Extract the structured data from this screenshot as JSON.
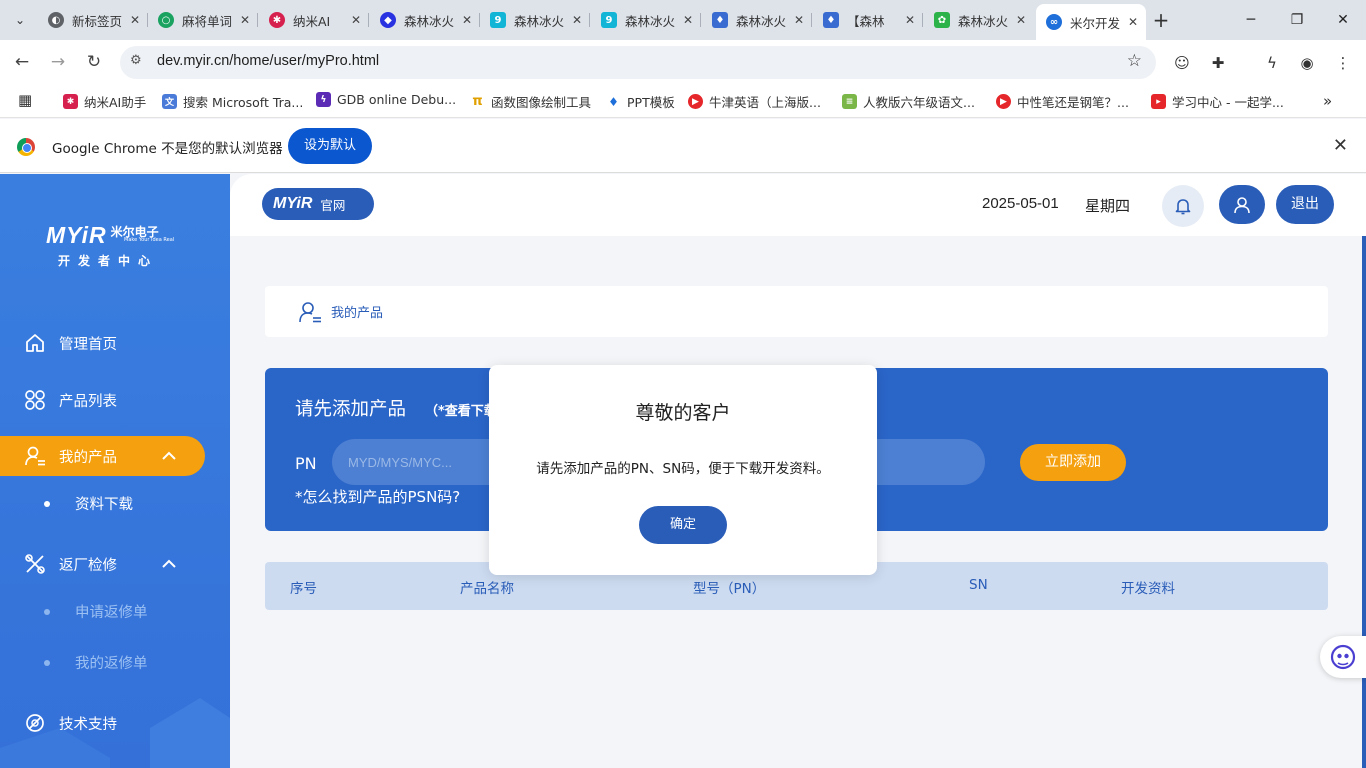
{
  "browser": {
    "tabs": [
      {
        "label": "新标签页",
        "favicon": "chrome-icon",
        "color": "#5f6368"
      },
      {
        "label": "麻将单词",
        "favicon": "loop-icon",
        "color": "#1aa260"
      },
      {
        "label": "纳米AI",
        "favicon": "nami-ai-icon",
        "color": "#d6204e"
      },
      {
        "label": "森林冰火",
        "favicon": "baidu-paw-icon",
        "color": "#2932e1"
      },
      {
        "label": "森林冰火",
        "favicon": "game-9-icon",
        "color": "#13b5d6"
      },
      {
        "label": "森林冰火",
        "favicon": "game-9-icon",
        "color": "#13b5d6"
      },
      {
        "label": "森林冰火",
        "favicon": "fire-water-icon",
        "color": "#3a6bd1"
      },
      {
        "label": "【森林",
        "favicon": "fire-water-icon",
        "color": "#3a6bd1"
      },
      {
        "label": "森林冰火",
        "favicon": "leaf-icon",
        "color": "#2bb34a"
      },
      {
        "label": "米尔开发",
        "favicon": "myir-icon",
        "color": "#1e6fd9"
      }
    ],
    "url": "dev.myir.cn/home/user/myPro.html",
    "bookmarks": [
      {
        "label": "纳米AI助手",
        "icon": "nami-ai-icon",
        "color": "#d6204e"
      },
      {
        "label": "搜索 Microsoft Tra...",
        "icon": "translator-icon",
        "color": "#4b7bd8"
      },
      {
        "label": "GDB online Debu...",
        "icon": "gdb-icon",
        "color": "#5b2bb5"
      },
      {
        "label": "函数图像绘制工具",
        "icon": "pi-icon",
        "color": "#e0a100"
      },
      {
        "label": "PPT模板",
        "icon": "ppt-icon",
        "color": "#1e6fd9"
      },
      {
        "label": "牛津英语（上海版...",
        "icon": "video-icon",
        "color": "#e5262a"
      },
      {
        "label": "人教版六年级语文...",
        "icon": "book-icon",
        "color": "#7ab648"
      },
      {
        "label": "中性笔还是钢笔？...",
        "icon": "video-icon",
        "color": "#e5262a"
      },
      {
        "label": "学习中心 - 一起学...",
        "icon": "study-icon",
        "color": "#e5262a"
      }
    ],
    "infobar": {
      "message": "Google Chrome 不是您的默认浏览器",
      "button": "设为默认"
    }
  },
  "sidebar": {
    "logo": {
      "brand": "MYiR",
      "cn": "米尔电子",
      "slogan": "Make Your Idea Real",
      "sub": "开发者中心"
    },
    "items": [
      {
        "label": "管理首页",
        "icon": "home-icon"
      },
      {
        "label": "产品列表",
        "icon": "grid-icon"
      },
      {
        "label": "我的产品",
        "icon": "user-list-icon",
        "active": true
      },
      {
        "label": "返厂检修",
        "icon": "tools-icon"
      },
      {
        "label": "技术支持",
        "icon": "support-icon"
      }
    ],
    "submenus": {
      "my_products": [
        "资料下载"
      ],
      "repair": [
        "申请返修单",
        "我的返修单"
      ]
    }
  },
  "header": {
    "brand_logo": "MYiR",
    "brand_site": "官网",
    "date": "2025-05-01",
    "weekday": "星期四",
    "logout": "退出"
  },
  "content": {
    "breadcrumb": "我的产品",
    "add_title": "请先添加产品",
    "add_hint": "（*查看下载",
    "pn_label": "PN",
    "pn_placeholder": "MYD/MYS/MYC...",
    "add_button": "立即添加",
    "psn_link": "*怎么找到产品的PSN码?",
    "table_headers": [
      "序号",
      "产品名称",
      "型号（PN）",
      "SN",
      "开发资料"
    ]
  },
  "modal": {
    "title": "尊敬的客户",
    "body": "请先添加产品的PN、SN码，便于下载开发资料。",
    "ok": "确定"
  },
  "colors": {
    "sidebar": "#3a7fe0",
    "primary": "#2a5db8",
    "accent": "#f5a00e",
    "panel": "#2a65c8",
    "table_head": "#cddbf1"
  }
}
